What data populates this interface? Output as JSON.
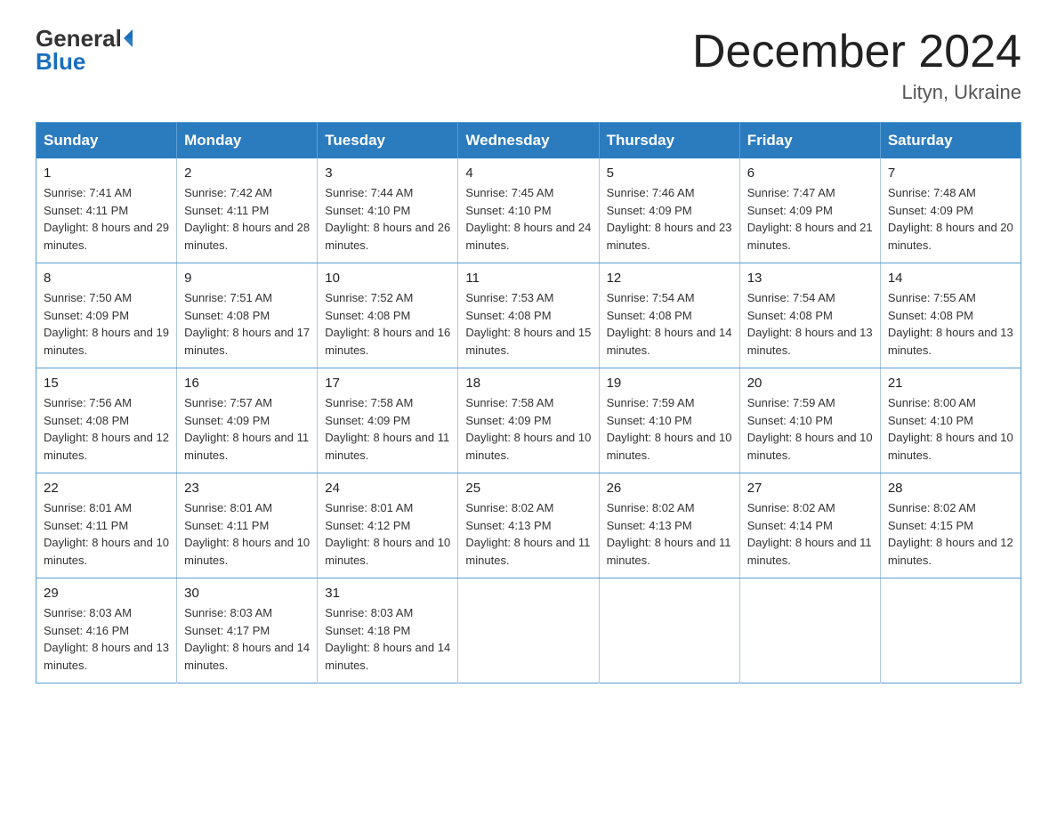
{
  "header": {
    "logo_general": "General",
    "logo_blue": "Blue",
    "month_title": "December 2024",
    "location": "Lityn, Ukraine"
  },
  "days_of_week": [
    "Sunday",
    "Monday",
    "Tuesday",
    "Wednesday",
    "Thursday",
    "Friday",
    "Saturday"
  ],
  "weeks": [
    [
      {
        "day": "1",
        "sunrise": "7:41 AM",
        "sunset": "4:11 PM",
        "daylight": "8 hours and 29 minutes."
      },
      {
        "day": "2",
        "sunrise": "7:42 AM",
        "sunset": "4:11 PM",
        "daylight": "8 hours and 28 minutes."
      },
      {
        "day": "3",
        "sunrise": "7:44 AM",
        "sunset": "4:10 PM",
        "daylight": "8 hours and 26 minutes."
      },
      {
        "day": "4",
        "sunrise": "7:45 AM",
        "sunset": "4:10 PM",
        "daylight": "8 hours and 24 minutes."
      },
      {
        "day": "5",
        "sunrise": "7:46 AM",
        "sunset": "4:09 PM",
        "daylight": "8 hours and 23 minutes."
      },
      {
        "day": "6",
        "sunrise": "7:47 AM",
        "sunset": "4:09 PM",
        "daylight": "8 hours and 21 minutes."
      },
      {
        "day": "7",
        "sunrise": "7:48 AM",
        "sunset": "4:09 PM",
        "daylight": "8 hours and 20 minutes."
      }
    ],
    [
      {
        "day": "8",
        "sunrise": "7:50 AM",
        "sunset": "4:09 PM",
        "daylight": "8 hours and 19 minutes."
      },
      {
        "day": "9",
        "sunrise": "7:51 AM",
        "sunset": "4:08 PM",
        "daylight": "8 hours and 17 minutes."
      },
      {
        "day": "10",
        "sunrise": "7:52 AM",
        "sunset": "4:08 PM",
        "daylight": "8 hours and 16 minutes."
      },
      {
        "day": "11",
        "sunrise": "7:53 AM",
        "sunset": "4:08 PM",
        "daylight": "8 hours and 15 minutes."
      },
      {
        "day": "12",
        "sunrise": "7:54 AM",
        "sunset": "4:08 PM",
        "daylight": "8 hours and 14 minutes."
      },
      {
        "day": "13",
        "sunrise": "7:54 AM",
        "sunset": "4:08 PM",
        "daylight": "8 hours and 13 minutes."
      },
      {
        "day": "14",
        "sunrise": "7:55 AM",
        "sunset": "4:08 PM",
        "daylight": "8 hours and 13 minutes."
      }
    ],
    [
      {
        "day": "15",
        "sunrise": "7:56 AM",
        "sunset": "4:08 PM",
        "daylight": "8 hours and 12 minutes."
      },
      {
        "day": "16",
        "sunrise": "7:57 AM",
        "sunset": "4:09 PM",
        "daylight": "8 hours and 11 minutes."
      },
      {
        "day": "17",
        "sunrise": "7:58 AM",
        "sunset": "4:09 PM",
        "daylight": "8 hours and 11 minutes."
      },
      {
        "day": "18",
        "sunrise": "7:58 AM",
        "sunset": "4:09 PM",
        "daylight": "8 hours and 10 minutes."
      },
      {
        "day": "19",
        "sunrise": "7:59 AM",
        "sunset": "4:10 PM",
        "daylight": "8 hours and 10 minutes."
      },
      {
        "day": "20",
        "sunrise": "7:59 AM",
        "sunset": "4:10 PM",
        "daylight": "8 hours and 10 minutes."
      },
      {
        "day": "21",
        "sunrise": "8:00 AM",
        "sunset": "4:10 PM",
        "daylight": "8 hours and 10 minutes."
      }
    ],
    [
      {
        "day": "22",
        "sunrise": "8:01 AM",
        "sunset": "4:11 PM",
        "daylight": "8 hours and 10 minutes."
      },
      {
        "day": "23",
        "sunrise": "8:01 AM",
        "sunset": "4:11 PM",
        "daylight": "8 hours and 10 minutes."
      },
      {
        "day": "24",
        "sunrise": "8:01 AM",
        "sunset": "4:12 PM",
        "daylight": "8 hours and 10 minutes."
      },
      {
        "day": "25",
        "sunrise": "8:02 AM",
        "sunset": "4:13 PM",
        "daylight": "8 hours and 11 minutes."
      },
      {
        "day": "26",
        "sunrise": "8:02 AM",
        "sunset": "4:13 PM",
        "daylight": "8 hours and 11 minutes."
      },
      {
        "day": "27",
        "sunrise": "8:02 AM",
        "sunset": "4:14 PM",
        "daylight": "8 hours and 11 minutes."
      },
      {
        "day": "28",
        "sunrise": "8:02 AM",
        "sunset": "4:15 PM",
        "daylight": "8 hours and 12 minutes."
      }
    ],
    [
      {
        "day": "29",
        "sunrise": "8:03 AM",
        "sunset": "4:16 PM",
        "daylight": "8 hours and 13 minutes."
      },
      {
        "day": "30",
        "sunrise": "8:03 AM",
        "sunset": "4:17 PM",
        "daylight": "8 hours and 14 minutes."
      },
      {
        "day": "31",
        "sunrise": "8:03 AM",
        "sunset": "4:18 PM",
        "daylight": "8 hours and 14 minutes."
      },
      null,
      null,
      null,
      null
    ]
  ],
  "colors": {
    "header_bg": "#2b7bbf",
    "border": "#5a9fd4",
    "logo_blue": "#1a6ebd"
  }
}
